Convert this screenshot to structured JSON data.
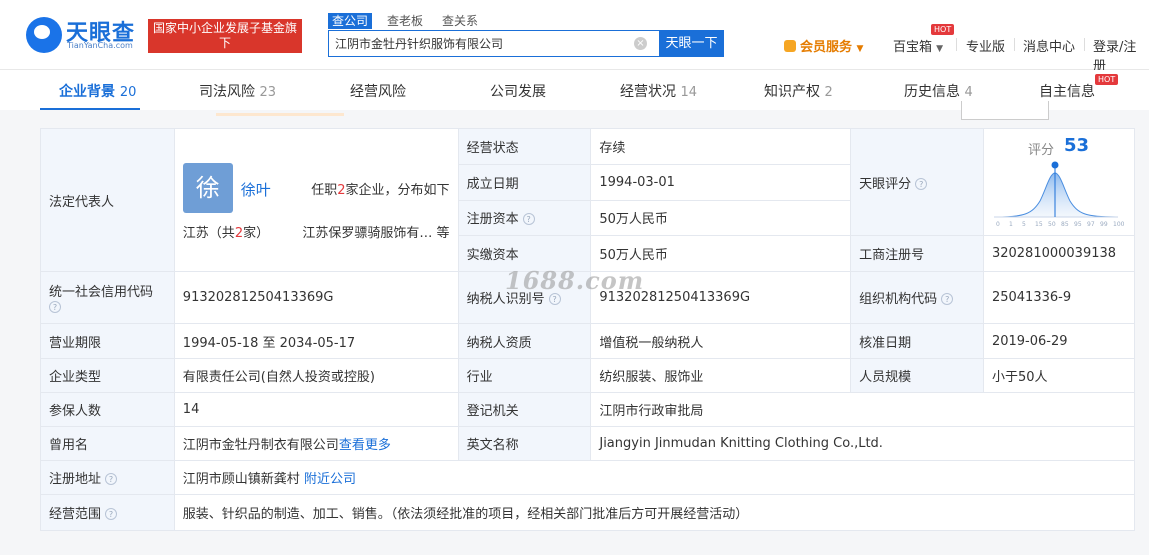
{
  "header": {
    "logo_text": "天眼查",
    "logo_sub": "TianYanCha.com",
    "fund_banner": "国家中小企业发展子基金旗下",
    "search_tabs": [
      "查公司",
      "查老板",
      "查关系"
    ],
    "search_value": "江阴市金牡丹针织服饰有限公司",
    "search_button": "天眼一下",
    "nav": {
      "vip": "会员服务",
      "baobao": "百宝箱",
      "pro": "专业版",
      "messages": "消息中心",
      "login": "登录/注册"
    },
    "hot_badge": "HOT"
  },
  "tabs": [
    {
      "label": "企业背景",
      "count": "20"
    },
    {
      "label": "司法风险",
      "count": "23"
    },
    {
      "label": "经营风险",
      "count": ""
    },
    {
      "label": "公司发展",
      "count": ""
    },
    {
      "label": "经营状况",
      "count": "14"
    },
    {
      "label": "知识产权",
      "count": "2"
    },
    {
      "label": "历史信息",
      "count": "4"
    },
    {
      "label": "自主信息",
      "count": ""
    }
  ],
  "legal_rep": {
    "label": "法定代表人",
    "avatar_char": "徐",
    "name": "徐叶",
    "info_prefix": "任职",
    "info_count": "2",
    "info_suffix": "家企业，分布如下",
    "region_prefix": "江苏（共",
    "region_count": "2",
    "region_suffix": "家）",
    "company": "江苏保罗骠骑服饰有… 等"
  },
  "status": {
    "label": "经营状态",
    "value": "存续"
  },
  "founded": {
    "label": "成立日期",
    "value": "1994-03-01"
  },
  "reg_capital": {
    "label": "注册资本",
    "value": "50万人民币"
  },
  "paid_capital": {
    "label": "实缴资本",
    "value": "50万人民币"
  },
  "tianyan_score": {
    "label": "天眼评分",
    "score_label": "评分",
    "score": "53",
    "axis_ticks": [
      "0",
      "1",
      "5",
      "15",
      "50",
      "85",
      "95",
      "97",
      "99",
      "100"
    ]
  },
  "biz_reg_no": {
    "label": "工商注册号",
    "value": "320281000039138"
  },
  "credit_code": {
    "label": "统一社会信用代码",
    "value": "91320281250413369G"
  },
  "taxpayer_id": {
    "label": "纳税人识别号",
    "value": "91320281250413369G"
  },
  "org_code": {
    "label": "组织机构代码",
    "value": "25041336-9"
  },
  "biz_term": {
    "label": "营业期限",
    "value": "1994-05-18 至 2034-05-17"
  },
  "taxpayer_type": {
    "label": "纳税人资质",
    "value": "增值税一般纳税人"
  },
  "approval_date": {
    "label": "核准日期",
    "value": "2019-06-29"
  },
  "company_type": {
    "label": "企业类型",
    "value": "有限责任公司(自然人投资或控股)"
  },
  "industry": {
    "label": "行业",
    "value": "纺织服装、服饰业"
  },
  "staff_size": {
    "label": "人员规模",
    "value": "小于50人"
  },
  "insured": {
    "label": "参保人数",
    "value": "14"
  },
  "reg_authority": {
    "label": "登记机关",
    "value": "江阴市行政审批局"
  },
  "former_name": {
    "label": "曾用名",
    "value": "江阴市金牡丹制衣有限公司",
    "link": "查看更多"
  },
  "english_name": {
    "label": "英文名称",
    "value": "Jiangyin Jinmudan Knitting Clothing Co.,Ltd."
  },
  "reg_address": {
    "label": "注册地址",
    "value": "江阴市顾山镇新龚村",
    "link": "附近公司"
  },
  "scope": {
    "label": "经营范围",
    "value": "服装、针织品的制造、加工、销售。（依法须经批准的项目，经相关部门批准后方可开展经营活动）"
  },
  "watermark": "1688.com",
  "colors": {
    "brand": "#1a6fd8",
    "fund_red": "#d9362b",
    "label_bg": "#f2f6fc",
    "vip_orange": "#e57c00"
  }
}
